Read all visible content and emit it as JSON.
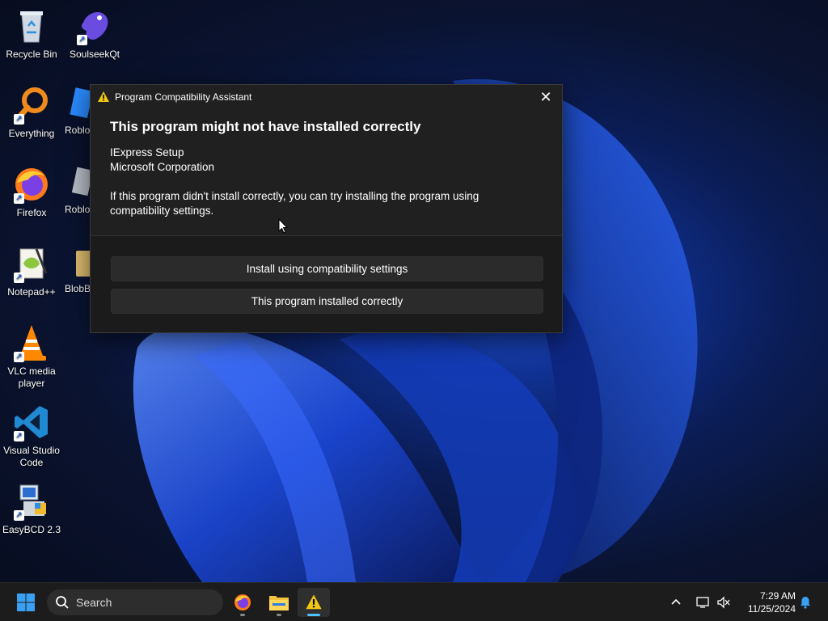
{
  "desktop": {
    "icons": [
      {
        "label": "Recycle Bin"
      },
      {
        "label": "SoulseekQt"
      },
      {
        "label": "Everything"
      },
      {
        "label": "Roblo"
      },
      {
        "label": "Firefox"
      },
      {
        "label": "Roblo"
      },
      {
        "label": "Notepad++"
      },
      {
        "label": "BlobB"
      },
      {
        "label": "VLC media player"
      },
      {
        "label": "Visual Studio Code"
      },
      {
        "label": "EasyBCD 2.3"
      }
    ]
  },
  "dialog": {
    "title": "Program Compatibility Assistant",
    "heading": "This program might not have installed correctly",
    "program_name": "IExpress Setup",
    "publisher": "Microsoft Corporation",
    "description": "If this program didn't install correctly, you can try installing the program using compatibility settings.",
    "buttons": {
      "install_compat": "Install using compatibility settings",
      "installed_correctly": "This program installed correctly"
    },
    "close_glyph": "✕"
  },
  "taskbar": {
    "search_label": "Search",
    "apps": [
      "firefox-icon",
      "file-explorer-icon",
      "compatibility-assistant-icon"
    ],
    "time": "7:29 AM",
    "date": "11/25/2024"
  },
  "colors": {
    "dialog_bg": "#202020",
    "button_bg": "#2b2b2b",
    "accent": "#4cc2ff"
  }
}
